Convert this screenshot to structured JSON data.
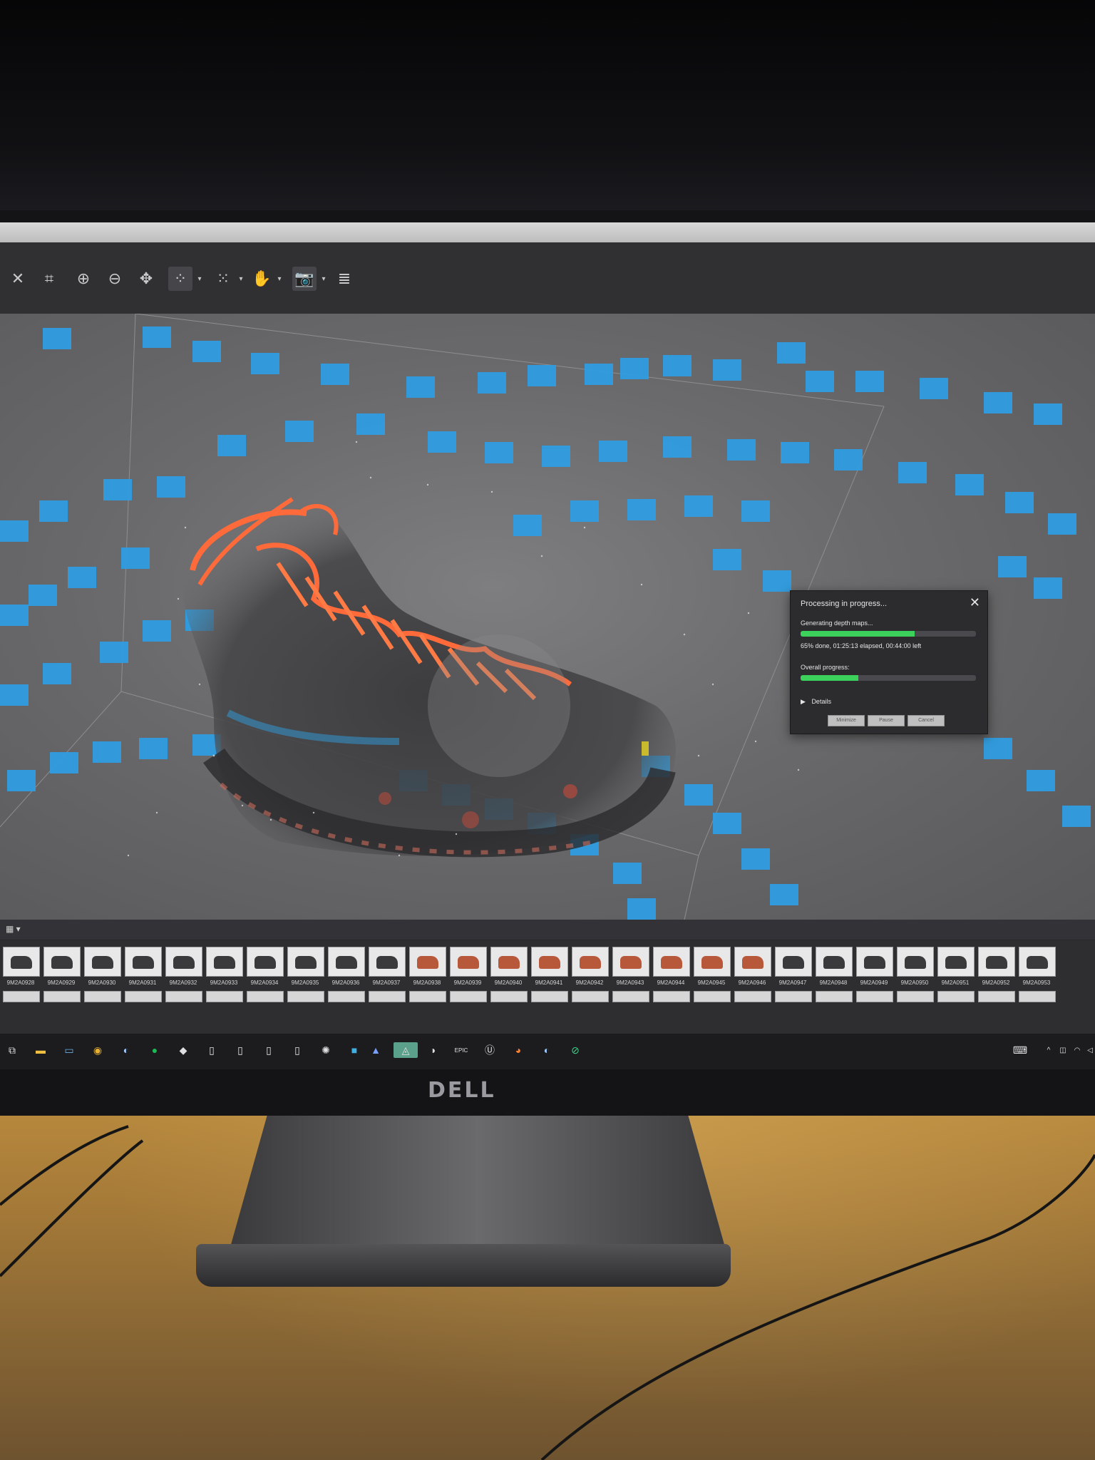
{
  "dialog": {
    "title": "Processing in progress...",
    "stage_label": "Generating depth maps...",
    "stage_progress": 0.65,
    "status_text": "65% done, 01:25:13 elapsed, 00:44:00 left",
    "overall_label": "Overall progress:",
    "overall_progress": 0.33,
    "details_label": "Details",
    "buttons": {
      "minimize": "Minimize",
      "pause": "Pause",
      "cancel": "Cancel"
    }
  },
  "toolbar": {
    "icons": [
      "close-icon",
      "crop-icon",
      "zoom-in-icon",
      "zoom-out-icon",
      "move-icon",
      "dots-grid-icon",
      "small-dots-grid-icon",
      "hand-icon",
      "camera-icon",
      "layers-icon"
    ]
  },
  "thumbnails": [
    "9M2A0928",
    "9M2A0929",
    "9M2A0930",
    "9M2A0931",
    "9M2A0932",
    "9M2A0933",
    "9M2A0934",
    "9M2A0935",
    "9M2A0936",
    "9M2A0937",
    "9M2A0938",
    "9M2A0939",
    "9M2A0940",
    "9M2A0941",
    "9M2A0942",
    "9M2A0943",
    "9M2A0944",
    "9M2A0945",
    "9M2A0946",
    "9M2A0947",
    "9M2A0948",
    "9M2A0949",
    "9M2A0950",
    "9M2A0951",
    "9M2A0952",
    "9M2A0953"
  ],
  "brand": "DELL",
  "colors": {
    "camera_marker": "#2f9de0",
    "progress": "#3bd15a",
    "shoe_laces": "#ff6a3a"
  }
}
